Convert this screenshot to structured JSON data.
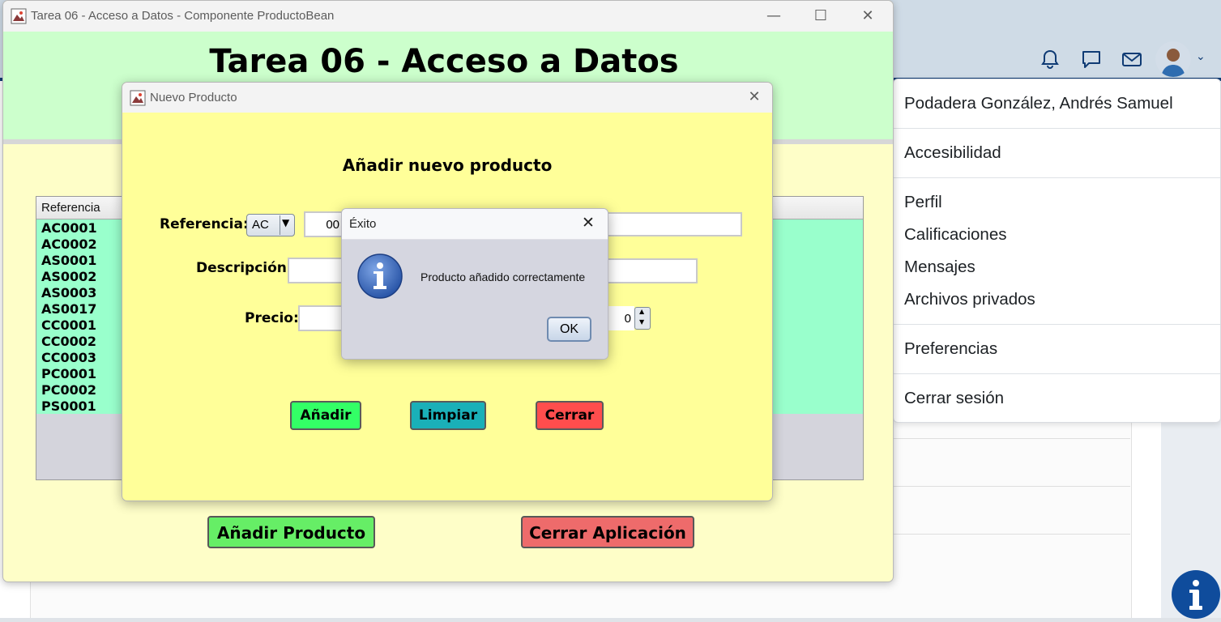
{
  "main_window": {
    "title": "Tarea 06 - Acceso a Datos - Componente ProductoBean",
    "header": "Tarea 06 - Acceso a Datos",
    "table_header": "Referencia",
    "rows": [
      "AC0001",
      "AC0002",
      "AS0001",
      "AS0002",
      "AS0003",
      "AS0017",
      "CC0001",
      "CC0002",
      "CC0003",
      "PC0001",
      "PC0002",
      "PS0001"
    ],
    "add_product_label": "Añadir Producto",
    "close_app_label": "Cerrar Aplicación"
  },
  "dialog": {
    "title": "Nuevo Producto",
    "heading": "Añadir nuevo producto",
    "referencia_label": "Referencia:",
    "referencia_prefix": "AC",
    "referencia_value": "00",
    "descripcion_label": "Descripción:",
    "precio_label": "Precio:",
    "stock_value": "0",
    "add_label": "Añadir",
    "clear_label": "Limpiar",
    "close_label": "Cerrar"
  },
  "success_dialog": {
    "title": "Éxito",
    "message": "Producto añadido correctamente",
    "ok_label": "OK"
  },
  "user_menu": {
    "name": "Podadera González, Andrés Samuel",
    "accessibility": "Accesibilidad",
    "profile": "Perfil",
    "grades": "Calificaciones",
    "messages": "Mensajes",
    "private_files": "Archivos privados",
    "preferences": "Preferencias",
    "logout": "Cerrar sesión"
  },
  "colors": {
    "header_green": "#ccffcc",
    "dialog_yellow": "#ffff99",
    "row_green": "#99ffcc",
    "add_green": "#33ff66",
    "clear_teal": "#1ab0b8",
    "close_red": "#ff4d4d"
  }
}
